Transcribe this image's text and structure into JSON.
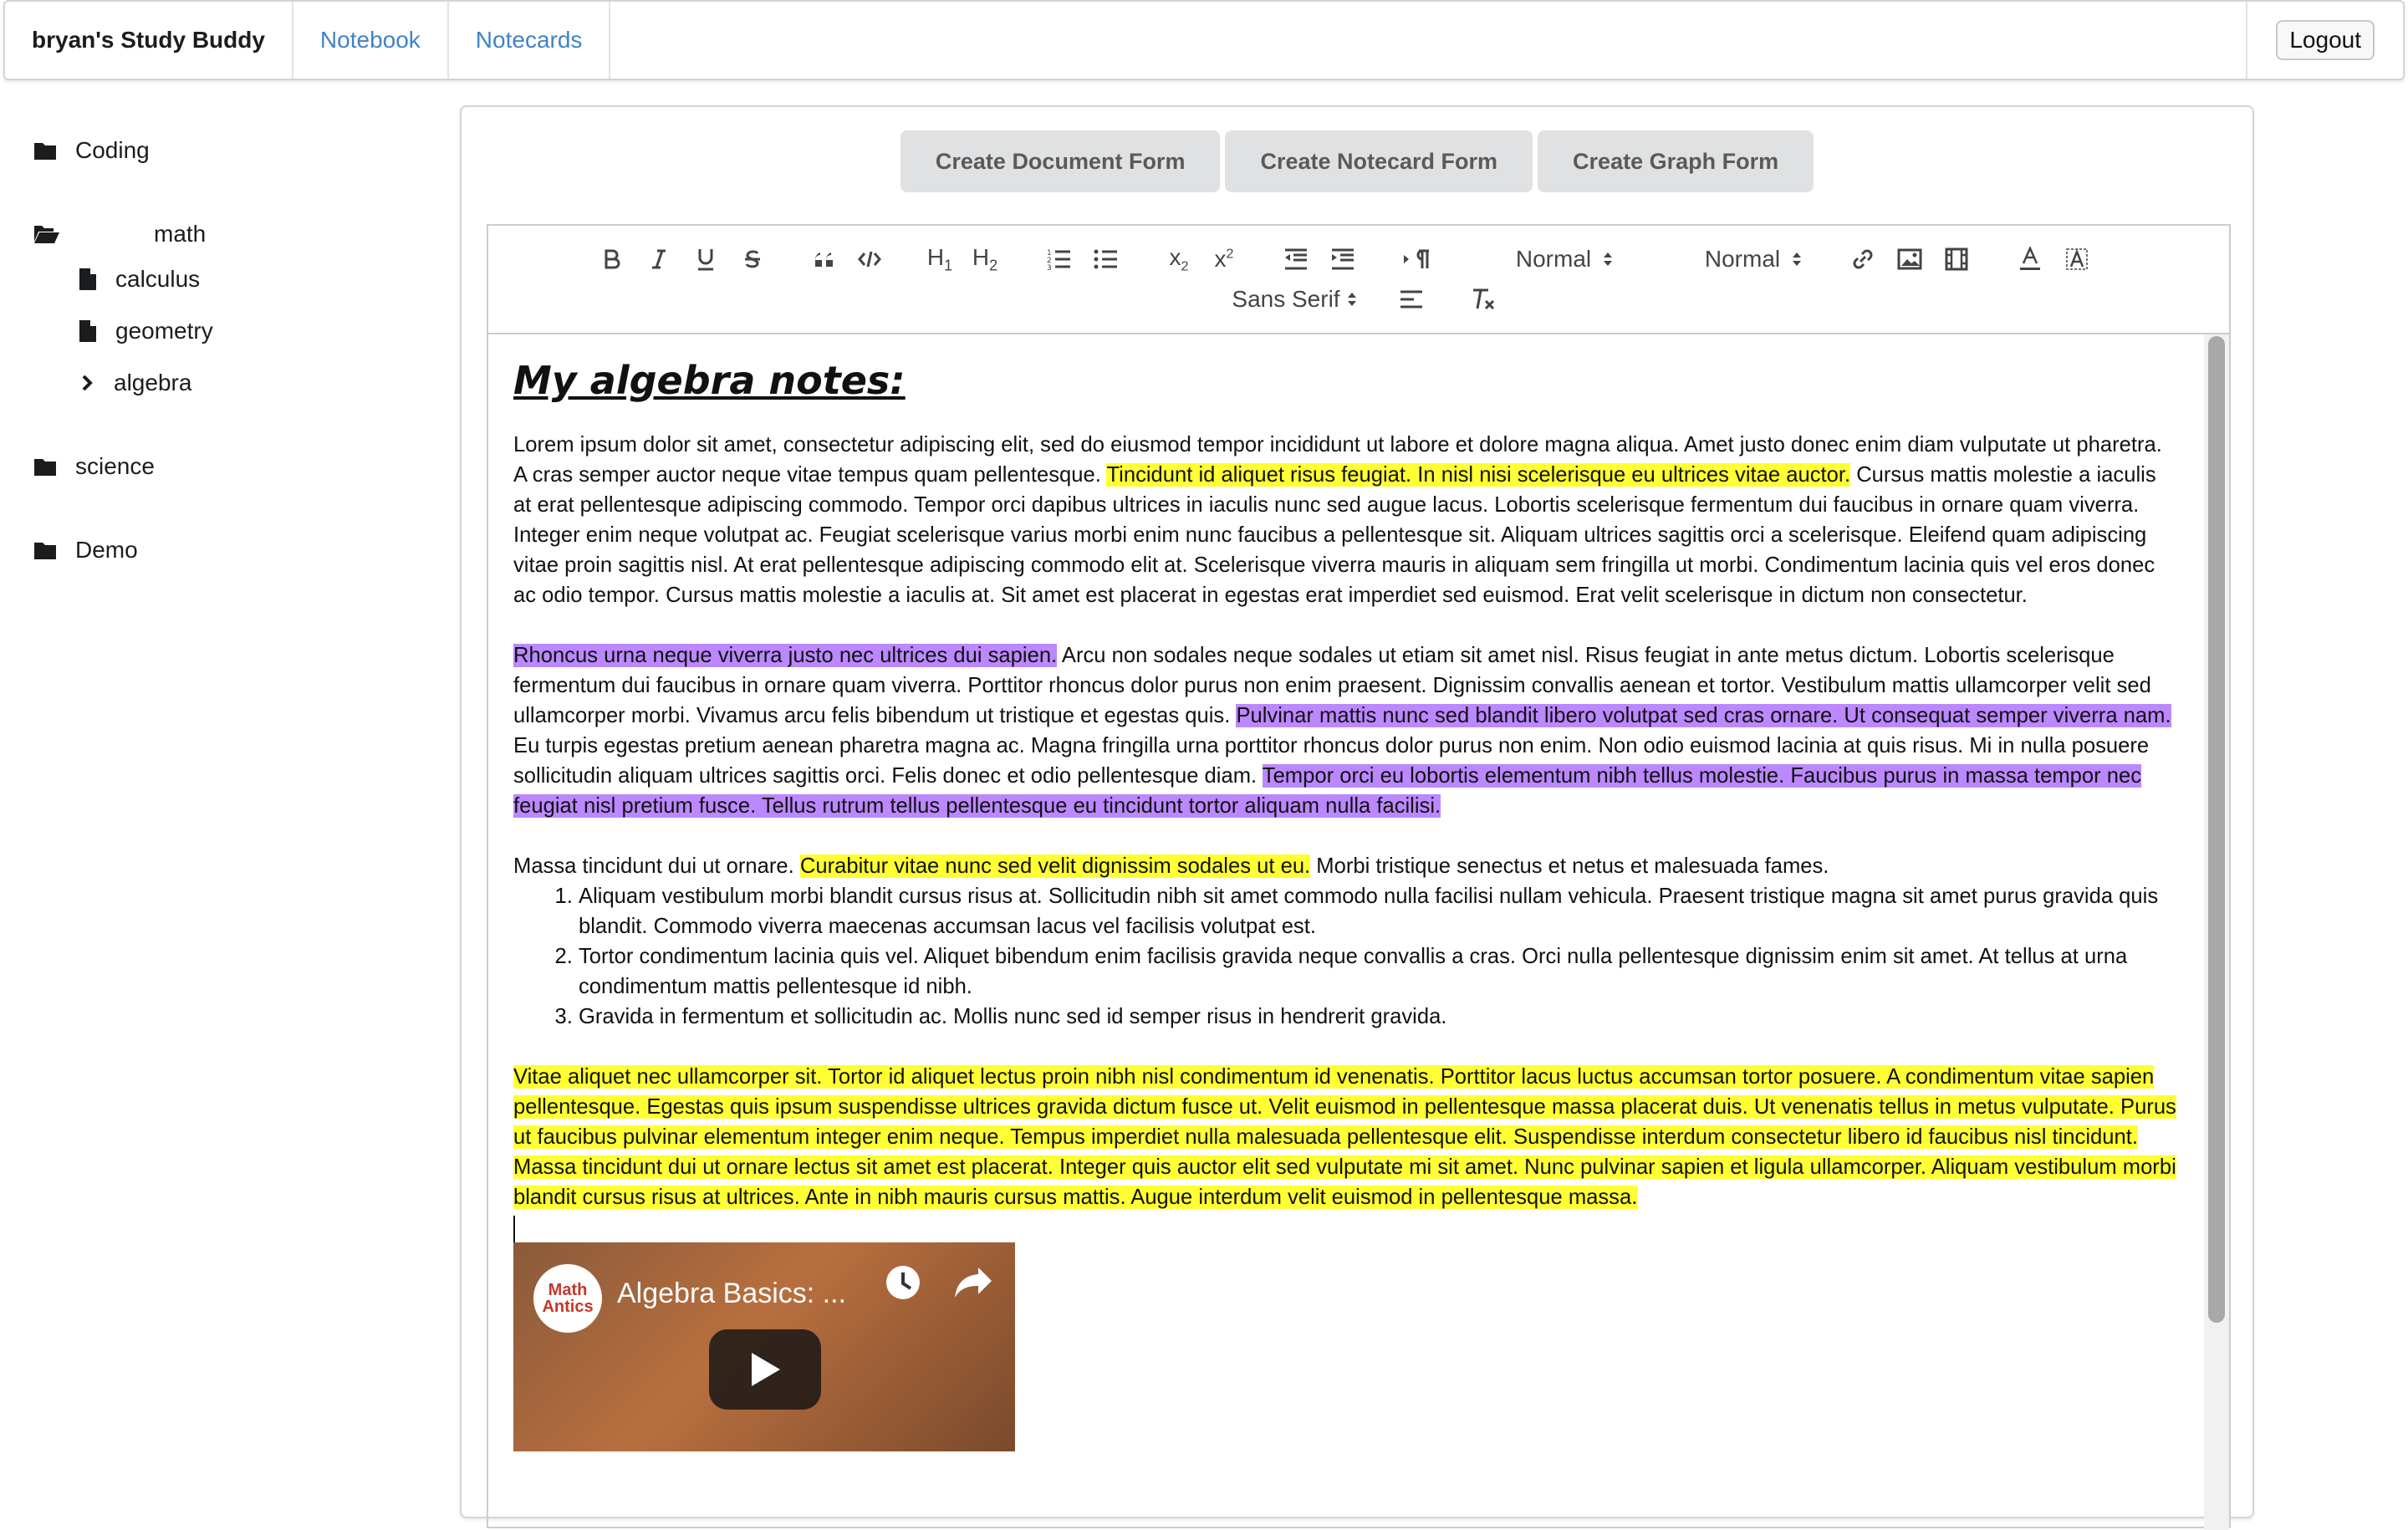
{
  "nav": {
    "brand": "bryan's Study Buddy",
    "links": [
      "Notebook",
      "Notecards"
    ],
    "logout": "Logout"
  },
  "sidebar": {
    "folders": [
      {
        "label": "Coding"
      },
      {
        "label": "math",
        "children": [
          "calculus",
          "geometry",
          "algebra"
        ]
      },
      {
        "label": "science"
      },
      {
        "label": "Demo"
      }
    ]
  },
  "forms": {
    "buttons": [
      "Create Document Form",
      "Create Notecard Form",
      "Create Graph Form"
    ]
  },
  "toolbar": {
    "header_select": "Normal",
    "size_select": "Normal",
    "font_select": "Sans Serif",
    "sub_label": "x",
    "sup_label": "x",
    "h1": "H",
    "h2": "H"
  },
  "document": {
    "title": "My algebra notes:",
    "p1": {
      "a": "Lorem ipsum dolor sit amet, consectetur adipiscing elit, sed do eiusmod tempor incididunt ut labore et dolore magna aliqua. Amet justo donec enim diam vulputate ut pharetra. A cras semper auctor neque vitae tempus quam pellentesque. ",
      "hl": "Tincidunt id aliquet risus feugiat. In nisl nisi scelerisque eu ultrices vitae auctor.",
      "b": " Cursus mattis molestie a iaculis at erat pellentesque adipiscing commodo. Tempor orci dapibus ultrices in iaculis nunc sed augue lacus. Lobortis scelerisque fermentum dui faucibus in ornare quam viverra. Integer enim neque volutpat ac. Feugiat scelerisque varius morbi enim nunc faucibus a pellentesque sit. Aliquam ultrices sagittis orci a scelerisque. Eleifend quam adipiscing vitae proin sagittis nisl. At erat pellentesque adipiscing commodo elit at. Scelerisque viverra mauris in aliquam sem fringilla ut morbi. Condimentum lacinia quis vel eros donec ac odio tempor. Cursus mattis molestie a iaculis at. Sit amet est placerat in egestas erat imperdiet sed euismod. Erat velit scelerisque in dictum non consectetur."
    },
    "p2": {
      "hl1": "Rhoncus urna neque viverra justo nec ultrices dui sapien.",
      "a": " Arcu non sodales neque sodales ut etiam sit amet nisl. Risus feugiat in ante metus dictum. Lobortis scelerisque fermentum dui faucibus in ornare quam viverra. Porttitor rhoncus dolor purus non enim praesent. Dignissim convallis aenean et tortor. Vestibulum mattis ullamcorper velit sed ullamcorper morbi. Vivamus arcu felis bibendum ut tristique et egestas quis. ",
      "hl2": "Pulvinar mattis nunc sed blandit libero volutpat sed cras ornare. Ut consequat semper viverra nam.",
      "b": " Eu turpis egestas pretium aenean pharetra magna ac. Magna fringilla urna porttitor rhoncus dolor purus non enim. Non odio euismod lacinia at quis risus. Mi in nulla posuere sollicitudin aliquam ultrices sagittis orci. Felis donec et odio pellentesque diam. ",
      "hl3": "Tempor orci eu lobortis elementum nibh tellus molestie. Faucibus purus in massa tempor nec feugiat nisl pretium fusce. Tellus rutrum tellus pellentesque eu tincidunt tortor aliquam nulla facilisi."
    },
    "p3": {
      "a": "Massa tincidunt dui ut ornare. ",
      "hl": "Curabitur vitae nunc sed velit dignissim sodales ut eu.",
      "b": " Morbi tristique senectus et netus et malesuada fames."
    },
    "list": [
      "Aliquam vestibulum morbi blandit cursus risus at. Sollicitudin nibh sit amet commodo nulla facilisi nullam vehicula. Praesent tristique magna sit amet purus gravida quis blandit. Commodo viverra maecenas accumsan lacus vel facilisis volutpat est.",
      "Tortor condimentum lacinia quis vel. Aliquet bibendum enim facilisis gravida neque convallis a cras. Orci nulla pellentesque dignissim enim sit amet. At tellus at urna condimentum mattis pellentesque id nibh.",
      "Gravida in fermentum et sollicitudin ac. Mollis nunc sed id semper risus in hendrerit gravida."
    ],
    "p4": "Vitae aliquet nec ullamcorper sit. Tortor id aliquet lectus proin nibh nisl condimentum id venenatis. Porttitor lacus luctus accumsan tortor posuere. A condimentum vitae sapien pellentesque. Egestas quis ipsum suspendisse ultrices gravida dictum fusce ut. Velit euismod in pellentesque massa placerat duis. Ut venenatis tellus in metus vulputate. Purus ut faucibus pulvinar elementum integer enim neque. Tempus imperdiet nulla malesuada pellentesque elit. Suspendisse interdum consectetur libero id faucibus nisl tincidunt. Massa tincidunt dui ut ornare lectus sit amet est placerat. Integer quis auctor elit sed vulputate mi sit amet. Nunc pulvinar sapien et ligula ullamcorper. Aliquam vestibulum morbi blandit cursus risus at ultrices. Ante in nibh mauris cursus mattis. Augue interdum velit euismod in pellentesque massa.",
    "video": {
      "title": "Algebra Basics: ...",
      "channel_logo": "Math Antics"
    }
  },
  "colors": {
    "highlight_yellow": "#ffff33",
    "highlight_purple": "#bb88ff",
    "link_blue": "#4183c4"
  },
  "icons": [
    "folder-icon",
    "folder-open-icon",
    "file-icon",
    "chevron-right-icon",
    "play-icon",
    "clock-icon",
    "share-icon"
  ]
}
